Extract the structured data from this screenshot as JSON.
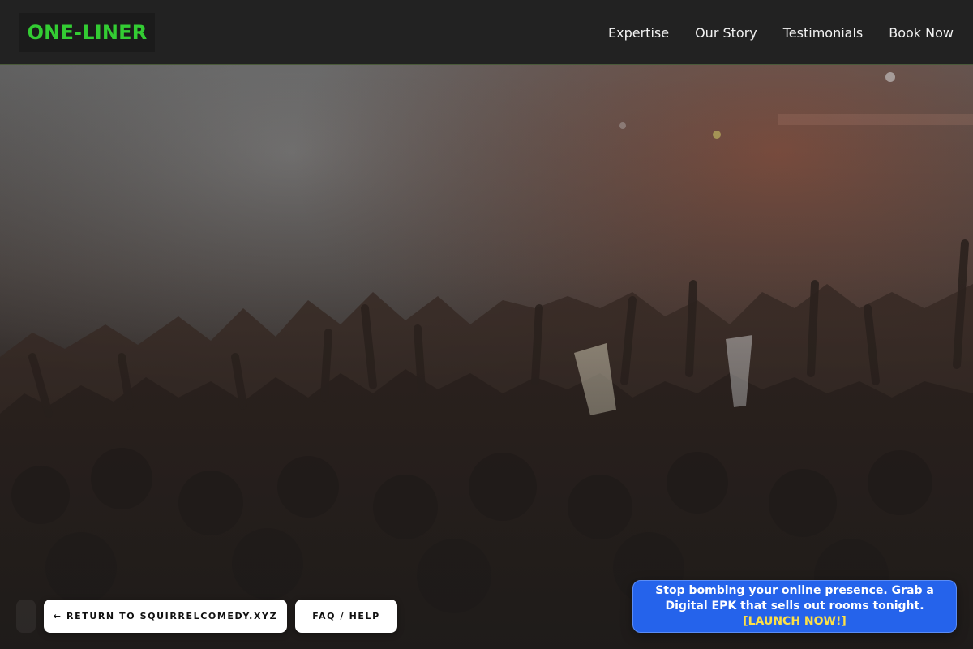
{
  "header": {
    "logo": "ONE-LINER",
    "nav": [
      {
        "label": "Expertise"
      },
      {
        "label": "Our Story"
      },
      {
        "label": "Testimonials"
      },
      {
        "label": "Book Now"
      }
    ]
  },
  "hero": {
    "image_description_icon": "concert-crowd-image"
  },
  "footer_actions": {
    "return_label": "← RETURN TO SQUIRRELCOMEDY.XYZ",
    "faq_label": "FAQ / HELP"
  },
  "promo": {
    "text": "Stop bombing your online presence. Grab a Digital EPK that sells out rooms tonight.",
    "cta": "[LAUNCH NOW!]"
  },
  "colors": {
    "logo_green": "#33cc33",
    "promo_blue": "#2563eb",
    "cta_yellow": "#fde047",
    "header_bg": "#222222"
  }
}
